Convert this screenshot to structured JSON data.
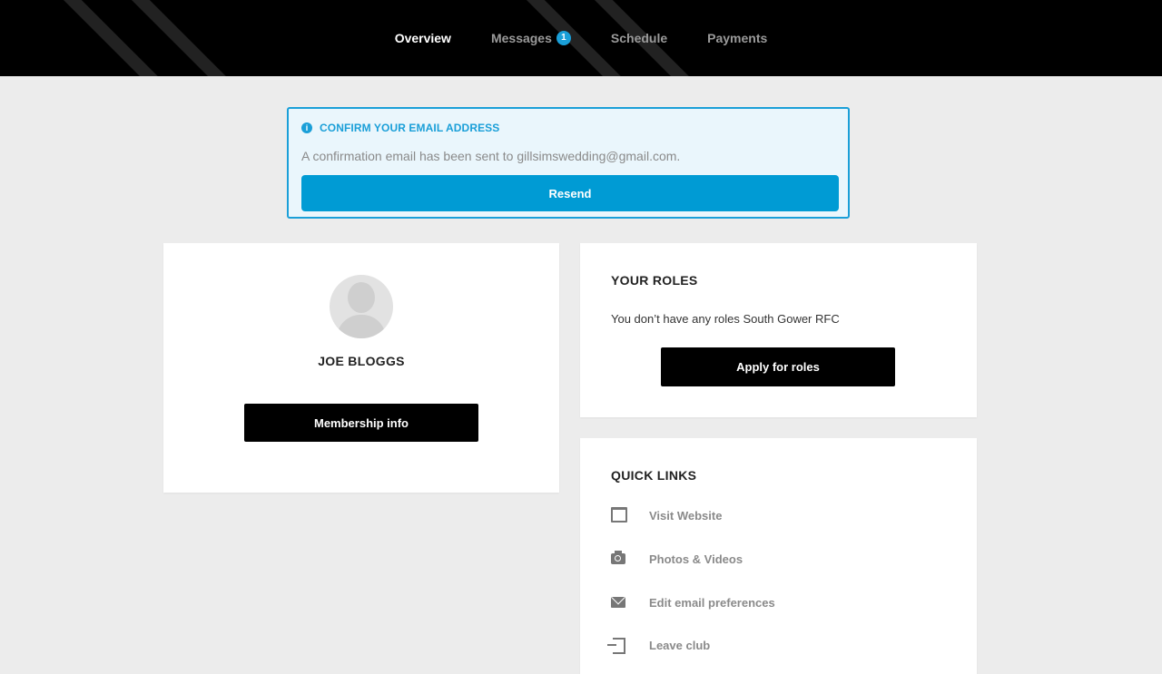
{
  "nav": {
    "items": [
      {
        "label": "Overview",
        "active": true
      },
      {
        "label": "Messages",
        "badge": "1"
      },
      {
        "label": "Schedule"
      },
      {
        "label": "Payments"
      }
    ]
  },
  "alert": {
    "icon": "info-icon",
    "title": "CONFIRM YOUR EMAIL ADDRESS",
    "text": "A confirmation email has been sent to gillsimswedding@gmail.com.",
    "button": "Resend",
    "color": "#1a9fd8"
  },
  "profile": {
    "name": "JOE BLOGGS",
    "button": "Membership info"
  },
  "roles": {
    "heading": "YOUR ROLES",
    "text": "You don’t have any roles South Gower RFC",
    "button": "Apply for roles"
  },
  "quick_links": {
    "heading": "QUICK LINKS",
    "items": [
      {
        "label": "Visit Website",
        "icon": "window-icon"
      },
      {
        "label": "Photos & Videos",
        "icon": "camera-icon"
      },
      {
        "label": "Edit email preferences",
        "icon": "mail-icon"
      },
      {
        "label": "Leave club",
        "icon": "exit-icon"
      }
    ]
  }
}
